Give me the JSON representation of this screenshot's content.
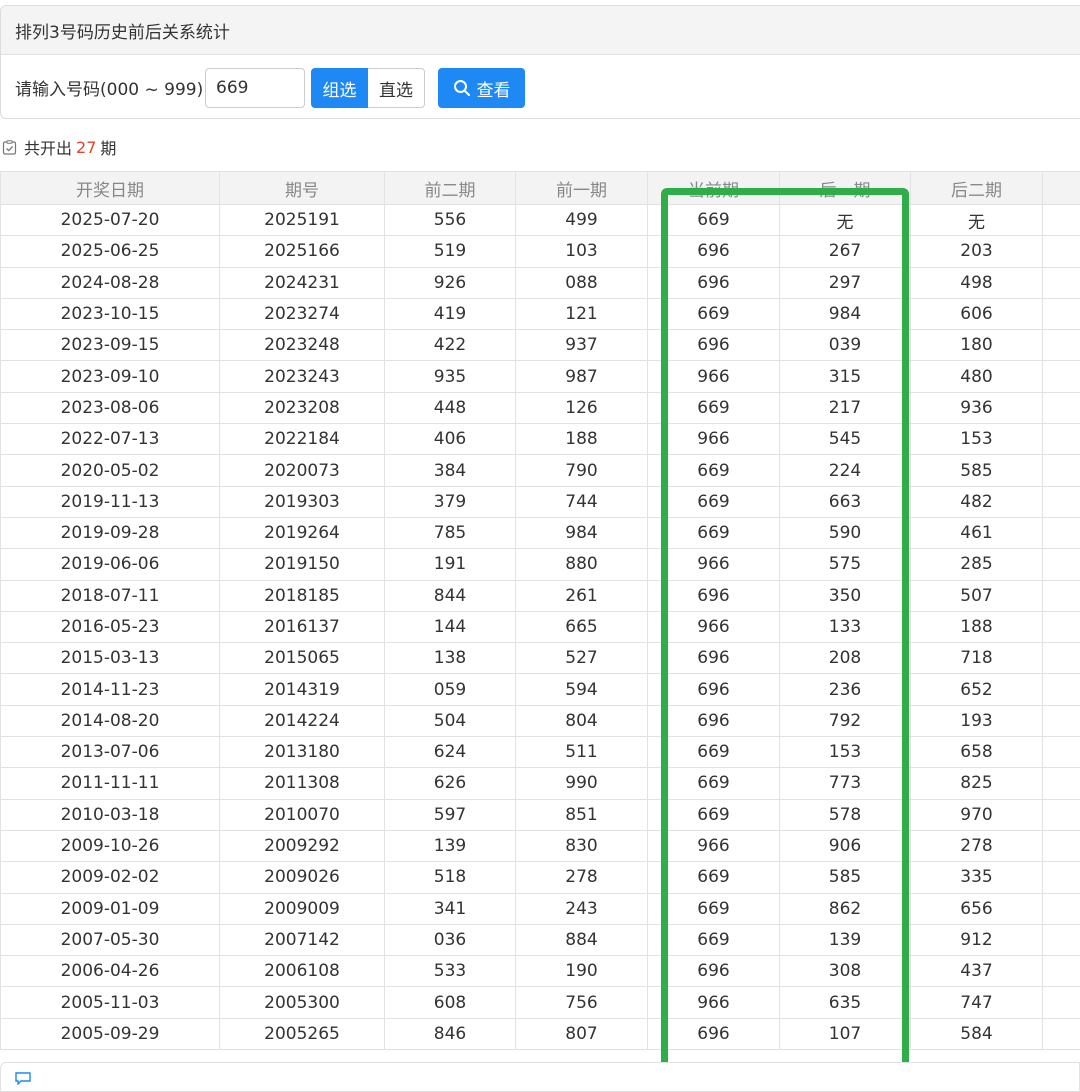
{
  "header": {
    "title": "排列3号码历史前后关系统计"
  },
  "search": {
    "label": "请输入号码(000 ~ 999)：",
    "value": "669",
    "mode_group": "组选",
    "mode_direct": "直选",
    "view_label": "查看"
  },
  "summary": {
    "prefix": "共开出",
    "count": "27",
    "suffix": "期"
  },
  "table": {
    "headers": [
      "开奖日期",
      "期号",
      "前二期",
      "前一期",
      "当前期",
      "后一期",
      "后二期"
    ],
    "rows": [
      [
        "2025-07-20",
        "2025191",
        "556",
        "499",
        "669",
        "无",
        "无"
      ],
      [
        "2025-06-25",
        "2025166",
        "519",
        "103",
        "696",
        "267",
        "203"
      ],
      [
        "2024-08-28",
        "2024231",
        "926",
        "088",
        "696",
        "297",
        "498"
      ],
      [
        "2023-10-15",
        "2023274",
        "419",
        "121",
        "669",
        "984",
        "606"
      ],
      [
        "2023-09-15",
        "2023248",
        "422",
        "937",
        "696",
        "039",
        "180"
      ],
      [
        "2023-09-10",
        "2023243",
        "935",
        "987",
        "966",
        "315",
        "480"
      ],
      [
        "2023-08-06",
        "2023208",
        "448",
        "126",
        "669",
        "217",
        "936"
      ],
      [
        "2022-07-13",
        "2022184",
        "406",
        "188",
        "966",
        "545",
        "153"
      ],
      [
        "2020-05-02",
        "2020073",
        "384",
        "790",
        "669",
        "224",
        "585"
      ],
      [
        "2019-11-13",
        "2019303",
        "379",
        "744",
        "669",
        "663",
        "482"
      ],
      [
        "2019-09-28",
        "2019264",
        "785",
        "984",
        "669",
        "590",
        "461"
      ],
      [
        "2019-06-06",
        "2019150",
        "191",
        "880",
        "966",
        "575",
        "285"
      ],
      [
        "2018-07-11",
        "2018185",
        "844",
        "261",
        "696",
        "350",
        "507"
      ],
      [
        "2016-05-23",
        "2016137",
        "144",
        "665",
        "966",
        "133",
        "188"
      ],
      [
        "2015-03-13",
        "2015065",
        "138",
        "527",
        "696",
        "208",
        "718"
      ],
      [
        "2014-11-23",
        "2014319",
        "059",
        "594",
        "696",
        "236",
        "652"
      ],
      [
        "2014-08-20",
        "2014224",
        "504",
        "804",
        "696",
        "792",
        "193"
      ],
      [
        "2013-07-06",
        "2013180",
        "624",
        "511",
        "669",
        "153",
        "658"
      ],
      [
        "2011-11-11",
        "2011308",
        "626",
        "990",
        "669",
        "773",
        "825"
      ],
      [
        "2010-03-18",
        "2010070",
        "597",
        "851",
        "669",
        "578",
        "970"
      ],
      [
        "2009-10-26",
        "2009292",
        "139",
        "830",
        "966",
        "906",
        "278"
      ],
      [
        "2009-02-02",
        "2009026",
        "518",
        "278",
        "669",
        "585",
        "335"
      ],
      [
        "2009-01-09",
        "2009009",
        "341",
        "243",
        "669",
        "862",
        "656"
      ],
      [
        "2007-05-30",
        "2007142",
        "036",
        "884",
        "669",
        "139",
        "912"
      ],
      [
        "2006-04-26",
        "2006108",
        "533",
        "190",
        "696",
        "308",
        "437"
      ],
      [
        "2005-11-03",
        "2005300",
        "608",
        "756",
        "966",
        "635",
        "747"
      ],
      [
        "2005-09-29",
        "2005265",
        "846",
        "807",
        "696",
        "107",
        "584"
      ]
    ]
  },
  "colors": {
    "accent": "#1e88f5",
    "highlight": "#2fad48",
    "count": "#e0422b"
  }
}
